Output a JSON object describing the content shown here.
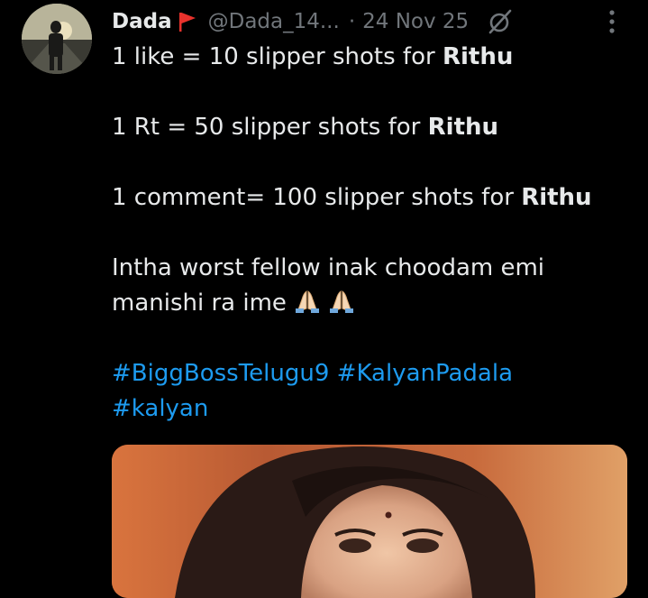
{
  "tweet": {
    "display_name": "Dada",
    "handle": "@Dada_14...",
    "separator": "·",
    "date": "24 Nov 25",
    "lines": {
      "line1_prefix": "1 like = 10 slipper shots for ",
      "line1_strong": "Rithu",
      "line2_prefix": "1 Rt = 50 slipper shots for ",
      "line2_strong": "Rithu",
      "line3_prefix": "1 comment= 100 slipper shots for ",
      "line3_strong": "Rithu",
      "line4": "Intha worst fellow inak choodam emi",
      "line5": "manishi ra ime"
    },
    "hashtags": {
      "tag1": "#BiggBossTelugu9",
      "tag2": "#KalyanPadala",
      "tag3": "#kalyan"
    }
  },
  "icons": {
    "flag": "red-flag-icon",
    "grok": "grok-icon",
    "more": "more-vertical-icon",
    "emoji": "folded-hands-emoji"
  },
  "colors": {
    "background": "#000000",
    "text": "#e7e9ea",
    "muted": "#71767b",
    "hashtag": "#1d9bf0",
    "flag": "#e8322c"
  }
}
